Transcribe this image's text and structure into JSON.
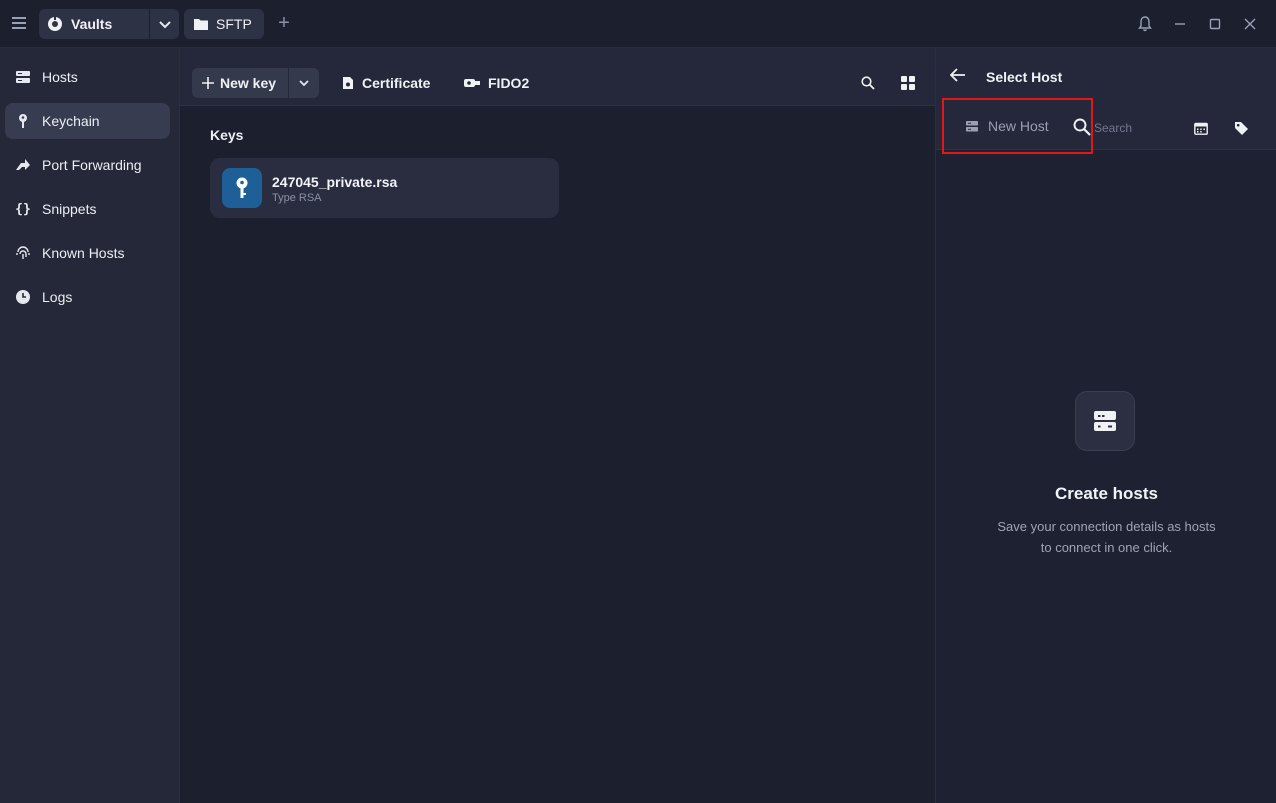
{
  "titlebar": {
    "vault_tab": "Vaults",
    "sftp_tab": "SFTP",
    "add_tab": "+"
  },
  "sidebar": {
    "items": [
      {
        "label": "Hosts",
        "icon": "server-icon"
      },
      {
        "label": "Keychain",
        "icon": "key-icon",
        "active": true
      },
      {
        "label": "Port Forwarding",
        "icon": "port-forward-icon"
      },
      {
        "label": "Snippets",
        "icon": "braces-icon"
      },
      {
        "label": "Known Hosts",
        "icon": "fingerprint-icon"
      },
      {
        "label": "Logs",
        "icon": "clock-icon"
      }
    ]
  },
  "toolbar": {
    "new_key": "New key",
    "certificate": "Certificate",
    "fido2": "FIDO2"
  },
  "keys": {
    "section_title": "Keys",
    "items": [
      {
        "name": "247045_private.rsa",
        "subtitle": "Type RSA"
      }
    ]
  },
  "panel": {
    "title": "Select Host",
    "new_host": "New Host",
    "search_placeholder": "Search",
    "empty_title": "Create hosts",
    "empty_line1": "Save your connection details as hosts",
    "empty_line2": "to connect in one click."
  },
  "colors": {
    "accent_key": "#1d5f96",
    "highlight_box": "#e01818",
    "background": "#1c1f2e"
  }
}
